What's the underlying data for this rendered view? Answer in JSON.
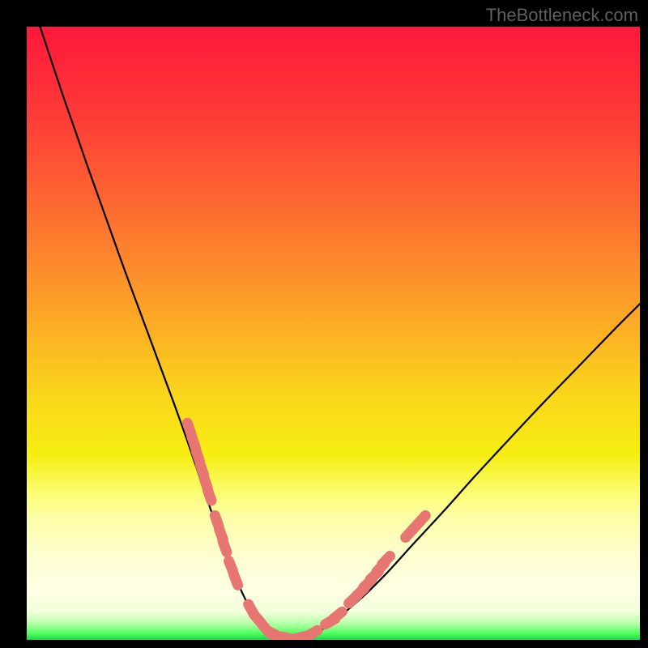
{
  "watermark": "TheBottleneck.com",
  "colors": {
    "frame": "#000000",
    "curve": "#000000",
    "marker": "#e77673",
    "gradient_stops": [
      {
        "offset": 0.0,
        "color": "#fe183b"
      },
      {
        "offset": 0.15,
        "color": "#fe3c37"
      },
      {
        "offset": 0.3,
        "color": "#fd6c31"
      },
      {
        "offset": 0.45,
        "color": "#fc9f28"
      },
      {
        "offset": 0.6,
        "color": "#fad61b"
      },
      {
        "offset": 0.7,
        "color": "#f6ee13"
      },
      {
        "offset": 0.76,
        "color": "#fbfd72"
      },
      {
        "offset": 0.8,
        "color": "#fdfea6"
      },
      {
        "offset": 0.86,
        "color": "#fefecf"
      },
      {
        "offset": 0.92,
        "color": "#feffe3"
      },
      {
        "offset": 0.955,
        "color": "#f1ffda"
      },
      {
        "offset": 0.975,
        "color": "#aeffa3"
      },
      {
        "offset": 0.99,
        "color": "#4bff5b"
      },
      {
        "offset": 1.0,
        "color": "#1fd24d"
      }
    ]
  },
  "chart_data": {
    "type": "line",
    "title": "",
    "xlabel": "",
    "ylabel": "",
    "xlim": [
      0,
      100
    ],
    "ylim": [
      0,
      100
    ],
    "legend": false,
    "grid": false,
    "series": [
      {
        "name": "bottleneck-curve",
        "x": [
          0,
          2,
          4,
          6,
          8,
          10,
          12,
          14,
          16,
          18,
          20,
          22,
          24,
          26,
          27.5,
          29,
          30.5,
          32,
          33.5,
          35,
          36.5,
          38,
          40,
          42.5,
          45,
          48,
          51,
          55,
          59,
          63,
          68,
          73,
          78,
          84,
          90,
          96,
          100
        ],
        "y": [
          106,
          100.5,
          94.5,
          88.5,
          82.8,
          77,
          71.4,
          65.8,
          60.2,
          54.8,
          49.4,
          44,
          38.6,
          33,
          28.6,
          24.2,
          19.8,
          15.6,
          11.6,
          8.0,
          5.0,
          2.6,
          0.9,
          0.2,
          0.4,
          1.6,
          3.8,
          7.2,
          11.2,
          15.6,
          21.0,
          26.6,
          32.0,
          38.4,
          44.6,
          50.8,
          54.8
        ]
      }
    ],
    "markers": [
      {
        "name": "cluster-left-upper",
        "points": [
          {
            "x": 26.5,
            "y": 34.5
          },
          {
            "x": 27.2,
            "y": 32.3
          },
          {
            "x": 27.9,
            "y": 30.0
          },
          {
            "x": 28.6,
            "y": 27.7
          },
          {
            "x": 29.2,
            "y": 25.6
          },
          {
            "x": 29.8,
            "y": 23.6
          }
        ]
      },
      {
        "name": "cluster-left-mid",
        "points": [
          {
            "x": 31.0,
            "y": 19.4
          },
          {
            "x": 31.7,
            "y": 17.2
          },
          {
            "x": 32.3,
            "y": 15.2
          }
        ]
      },
      {
        "name": "cluster-left-low",
        "points": [
          {
            "x": 33.3,
            "y": 12.0
          },
          {
            "x": 34.1,
            "y": 9.8
          }
        ]
      },
      {
        "name": "cluster-bottom",
        "points": [
          {
            "x": 36.6,
            "y": 5.0
          },
          {
            "x": 37.6,
            "y": 3.5
          },
          {
            "x": 39.0,
            "y": 1.8
          },
          {
            "x": 40.2,
            "y": 1.0
          },
          {
            "x": 41.4,
            "y": 0.5
          },
          {
            "x": 42.7,
            "y": 0.2
          },
          {
            "x": 44.0,
            "y": 0.25
          },
          {
            "x": 45.3,
            "y": 0.55
          },
          {
            "x": 46.6,
            "y": 1.1
          }
        ]
      },
      {
        "name": "cluster-right-low",
        "points": [
          {
            "x": 49.5,
            "y": 3.0
          },
          {
            "x": 50.7,
            "y": 4.0
          }
        ]
      },
      {
        "name": "cluster-right-mid",
        "points": [
          {
            "x": 53.2,
            "y": 6.6
          },
          {
            "x": 54.4,
            "y": 7.8
          },
          {
            "x": 55.6,
            "y": 9.2
          },
          {
            "x": 56.7,
            "y": 10.5
          },
          {
            "x": 57.7,
            "y": 11.8
          },
          {
            "x": 58.6,
            "y": 13.0
          }
        ]
      },
      {
        "name": "cluster-right-upper",
        "points": [
          {
            "x": 62.4,
            "y": 17.4
          },
          {
            "x": 63.4,
            "y": 18.5
          },
          {
            "x": 64.4,
            "y": 19.6
          }
        ]
      }
    ]
  }
}
